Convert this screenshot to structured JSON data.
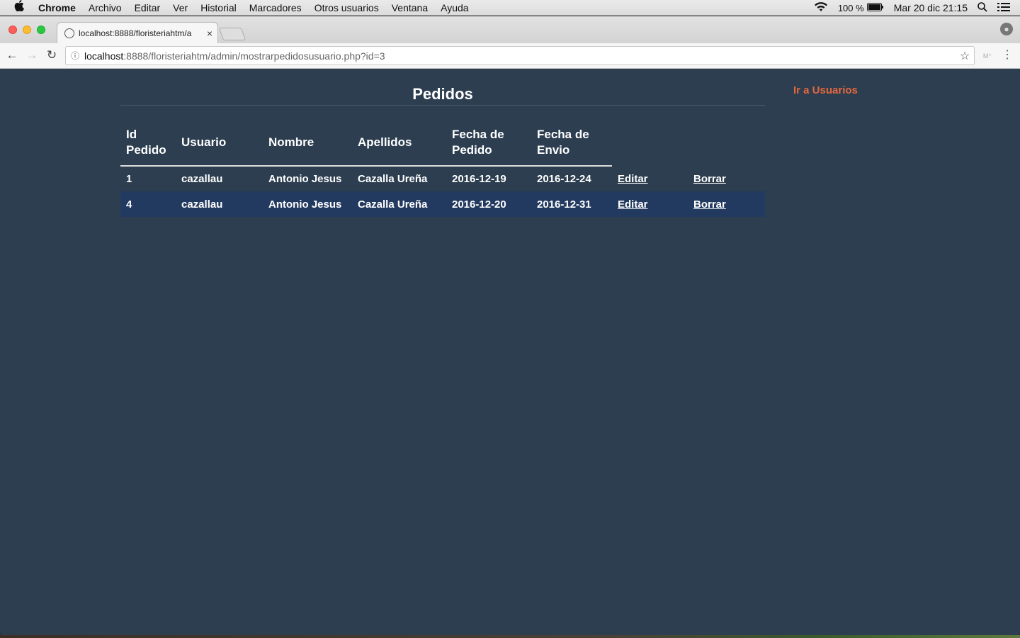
{
  "menubar": {
    "apple": "",
    "items": [
      "Chrome",
      "Archivo",
      "Editar",
      "Ver",
      "Historial",
      "Marcadores",
      "Otros usuarios",
      "Ventana",
      "Ayuda"
    ],
    "battery": "100 %",
    "datetime": "Mar 20 dic  21:15"
  },
  "browser": {
    "tab_title": "localhost:8888/floristeriahtm/a",
    "tab_close": "×",
    "url_host": "localhost",
    "url_path": ":8888/floristeriahtm/admin/mostrarpedidosusuario.php?id=3",
    "back": "←",
    "forward": "→",
    "reload": "↻",
    "info": "ⓘ",
    "star": "☆",
    "ext": "M⁺",
    "kebab": "⋮"
  },
  "page": {
    "title": "Pedidos",
    "nav_link": "Ir a Usuarios",
    "table": {
      "headers": {
        "id_pedido": "Id Pedido",
        "usuario": "Usuario",
        "nombre": "Nombre",
        "apellidos": "Apellidos",
        "fecha_pedido": "Fecha de Pedido",
        "fecha_envio": "Fecha de Envio"
      },
      "rows": [
        {
          "id": "1",
          "usuario": "cazallau",
          "nombre": "Antonio Jesus",
          "apellidos": "Cazalla Ureña",
          "fecha_pedido": "2016-12-19",
          "fecha_envio": "2016-12-24",
          "editar": "Editar",
          "borrar": "Borrar"
        },
        {
          "id": "4",
          "usuario": "cazallau",
          "nombre": "Antonio Jesus",
          "apellidos": "Cazalla Ureña",
          "fecha_pedido": "2016-12-20",
          "fecha_envio": "2016-12-31",
          "editar": "Editar",
          "borrar": "Borrar"
        }
      ]
    }
  },
  "colors": {
    "page_bg": "#2c3e50",
    "row_highlight": "#233a60",
    "nav_link": "#e5673f"
  }
}
